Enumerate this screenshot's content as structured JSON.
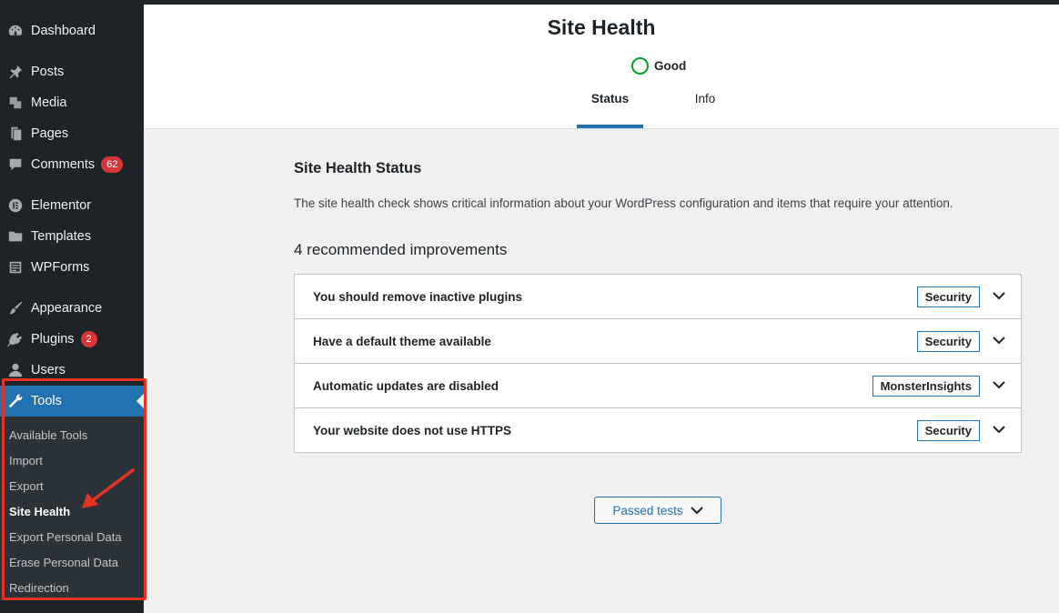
{
  "sidebar": {
    "items": [
      {
        "label": "Dashboard",
        "icon": "dashboard-icon"
      },
      {
        "label": "Posts",
        "icon": "pin-icon"
      },
      {
        "label": "Media",
        "icon": "media-icon"
      },
      {
        "label": "Pages",
        "icon": "pages-icon"
      },
      {
        "label": "Comments",
        "icon": "comment-icon",
        "badge": "62"
      },
      {
        "label": "Elementor",
        "icon": "elementor-icon"
      },
      {
        "label": "Templates",
        "icon": "folder-icon"
      },
      {
        "label": "WPForms",
        "icon": "forms-icon"
      },
      {
        "label": "Appearance",
        "icon": "brush-icon"
      },
      {
        "label": "Plugins",
        "icon": "plugin-icon",
        "badge": "2"
      },
      {
        "label": "Users",
        "icon": "user-icon"
      },
      {
        "label": "Tools",
        "icon": "wrench-icon"
      }
    ],
    "submenu": [
      "Available Tools",
      "Import",
      "Export",
      "Site Health",
      "Export Personal Data",
      "Erase Personal Data",
      "Redirection"
    ]
  },
  "header": {
    "title": "Site Health",
    "status": "Good",
    "tabs": [
      "Status",
      "Info"
    ]
  },
  "main": {
    "section_title": "Site Health Status",
    "description": "The site health check shows critical information about your WordPress configuration and items that require your attention.",
    "improvements_title": "4 recommended improvements",
    "issues": [
      {
        "label": "You should remove inactive plugins",
        "tag": "Security"
      },
      {
        "label": "Have a default theme available",
        "tag": "Security"
      },
      {
        "label": "Automatic updates are disabled",
        "tag": "MonsterInsights"
      },
      {
        "label": "Your website does not use HTTPS",
        "tag": "Security"
      }
    ],
    "passed_tests_label": "Passed tests"
  },
  "colors": {
    "sidebar_bg": "#1d2327",
    "accent": "#2271b1",
    "badge": "#d63638",
    "good": "#00a32a",
    "highlight": "#e53323"
  }
}
